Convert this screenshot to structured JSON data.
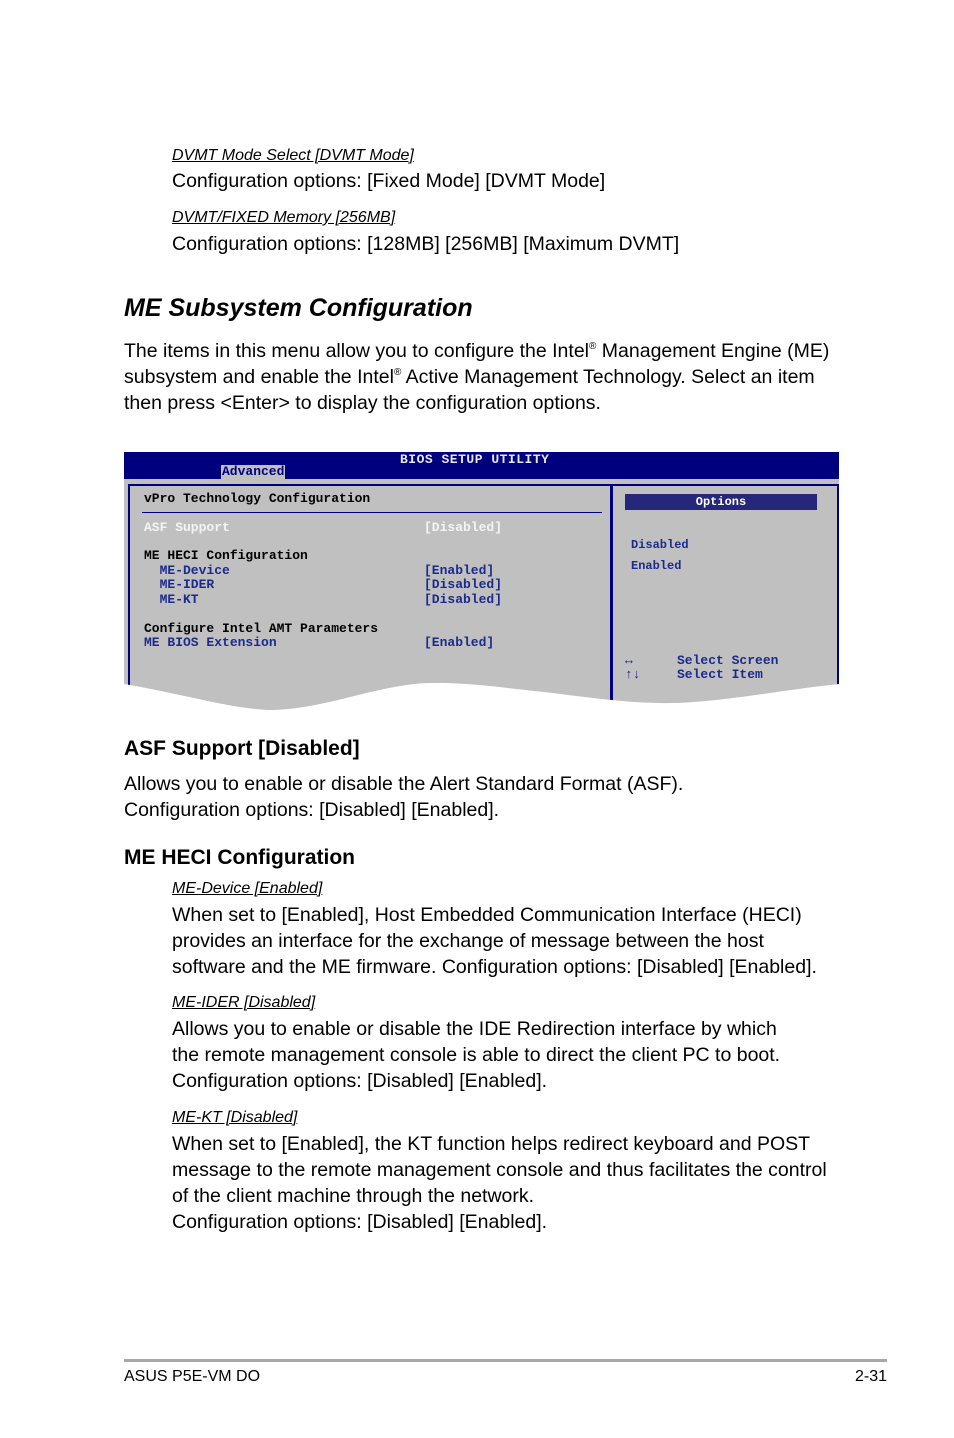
{
  "dvmt": {
    "mode_select_heading": "DVMT Mode Select [DVMT Mode]",
    "mode_select_options": "Configuration options:  [Fixed Mode] [DVMT Mode]",
    "memory_heading": "DVMT/FIXED Memory [256MB]",
    "memory_options": "Configuration options: [128MB] [256MB] [Maximum DVMT]"
  },
  "section": {
    "title": "ME Subsystem Configuration",
    "intro_line1_a": "The items in this menu allow you to configure the Intel",
    "intro_line1_b": " Management Engine (ME)",
    "intro_line2_a": "subsystem and enable the Intel",
    "intro_line2_b": " Active Management Technology. Select an item",
    "intro_line3": "then press <Enter> to display the configuration options.",
    "registered_mark": "®"
  },
  "bios": {
    "title": "BIOS SETUP UTILITY",
    "active_tab": "Advanced",
    "panel_title": "vPro Technology Configuration",
    "items": [
      {
        "label": "ASF Support",
        "value": "[Disabled]",
        "state": "selected"
      },
      {
        "label": "ME HECI Configuration",
        "value": "",
        "state": "header"
      },
      {
        "label": "  ME-Device",
        "value": "[Enabled]",
        "state": "option"
      },
      {
        "label": "  ME-IDER",
        "value": "[Disabled]",
        "state": "option"
      },
      {
        "label": "  ME-KT",
        "value": "[Disabled]",
        "state": "option"
      },
      {
        "label": "Configure Intel AMT Parameters",
        "value": "",
        "state": "header"
      },
      {
        "label": "ME BIOS Extension",
        "value": "[Enabled]",
        "state": "option"
      }
    ],
    "options_title": "Options",
    "options": [
      "Disabled",
      "Enabled"
    ],
    "help": [
      {
        "key": "↔",
        "text": "Select Screen"
      },
      {
        "key": "↑↓",
        "text": "Select Item"
      }
    ],
    "colors": {
      "title_bar": "#00007f",
      "background": "#c0c0c0",
      "item_text": "#1c2a8c"
    }
  },
  "asf": {
    "heading": "ASF Support [Disabled]",
    "line1": "Allows you to enable or disable the Alert Standard Format (ASF).",
    "line2": "Configuration options: [Disabled] [Enabled]."
  },
  "heci": {
    "heading": "ME HECI Configuration",
    "device": {
      "heading": "ME-Device [Enabled]",
      "lines": [
        "When set to [Enabled], Host Embedded Communication Interface (HECI)",
        "provides an interface for the exchange of message between the host",
        "software and the ME firmware. Configuration options: [Disabled] [Enabled]."
      ]
    },
    "ider": {
      "heading": "ME-IDER [Disabled]",
      "lines": [
        "Allows you to enable or disable the IDE Redirection interface by which",
        "the remote management console is able to direct the client PC to boot.",
        "Configuration options: [Disabled] [Enabled]."
      ]
    },
    "kt": {
      "heading": "ME-KT [Disabled]",
      "lines": [
        "When set to [Enabled], the KT function helps redirect keyboard and POST",
        "message to the remote management console and thus facilitates the control",
        "of the client machine through the network.",
        "Configuration options: [Disabled] [Enabled]."
      ]
    }
  },
  "footer": {
    "product": "ASUS P5E-VM DO",
    "page_number": "2-31"
  }
}
